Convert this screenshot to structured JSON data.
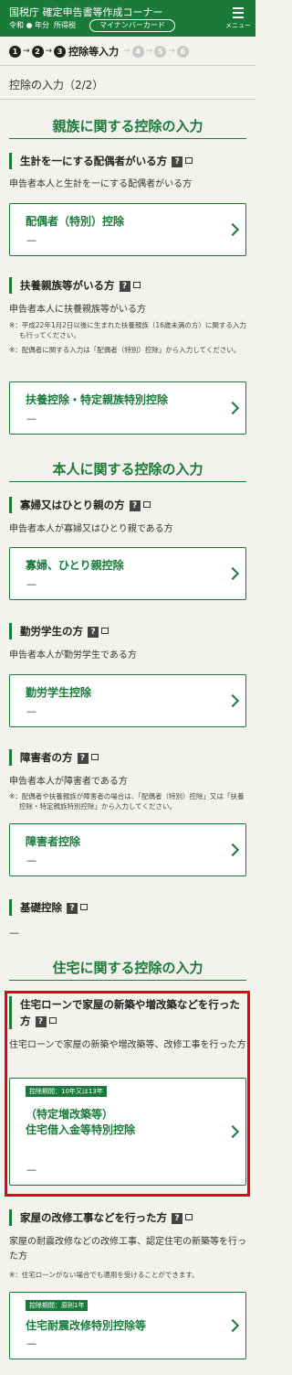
{
  "header": {
    "title": "国税庁 確定申告書等作成コーナー",
    "era": "令和",
    "year_label": "年分",
    "tax_type": "所得税",
    "mycard_label": "マイナンバーカード",
    "menu_label": "メニュー"
  },
  "steps": {
    "items": [
      "1",
      "2",
      "3",
      "4",
      "5",
      "6"
    ],
    "current_label": "控除等入力",
    "current_index": 3
  },
  "page_title": "控除の入力（2/2）",
  "sections": {
    "family": {
      "title": "親族に関する控除の入力",
      "spouse": {
        "title": "生計を一にする配偶者がいる方",
        "desc": "申告者本人と生計を一にする配偶者がいる方",
        "card_label": "配偶者（特別）控除",
        "card_value": "—"
      },
      "dependent": {
        "title": "扶養親族等がいる方",
        "desc": "申告者本人に扶養親族等がいる方",
        "note1": "※：平成22年1月2日以後に生まれた扶養親族（16歳未満の方）に関する入力も行ってください。",
        "note2": "※：配偶者に関する入力は「配偶者（特別）控除」から入力してください。",
        "card_label": "扶養控除・特定親族特別控除",
        "card_value": "—"
      }
    },
    "self": {
      "title": "本人に関する控除の入力",
      "widow": {
        "title": "寡婦又はひとり親の方",
        "desc": "申告者本人が寡婦又はひとり親である方",
        "card_label": "寡婦、ひとり親控除",
        "card_value": "—"
      },
      "student": {
        "title": "勤労学生の方",
        "desc": "申告者本人が勤労学生である方",
        "card_label": "勤労学生控除",
        "card_value": "—"
      },
      "disabled": {
        "title": "障害者の方",
        "desc": "申告者本人が障害者である方",
        "note": "※：配偶者や扶養親族が障害者の場合は、「配偶者（特別）控除」又は「扶養控除・特定親族特別控除」から入力してください。",
        "card_label": "障害者控除",
        "card_value": "—"
      },
      "basic": {
        "title": "基礎控除",
        "value": "—"
      }
    },
    "housing": {
      "title": "住宅に関する控除の入力",
      "loan": {
        "title": "住宅ローンで家屋の新築や増改築などを行った方",
        "desc": "住宅ローンで家屋の新築や増改築等、改修工事を行った方",
        "badge": "控除期間：10年又は13年",
        "card_label_1": "（特定増改築等）",
        "card_label_2": "住宅借入金等特別控除",
        "card_value": "—"
      },
      "renovation": {
        "title": "家屋の改修工事などを行った方",
        "desc": "家屋の耐震改修などの改修工事、認定住宅の新築等を行った方",
        "note": "※：住宅ローンがない場合でも適用を受けることができます。",
        "badge": "控除期間：原則1年",
        "card_label": "住宅耐震改修特別控除等",
        "card_value": "—"
      }
    }
  },
  "colors": {
    "brand_green": "#1a7a3a",
    "highlight_red": "#e60012",
    "background": "#f4f2ec"
  }
}
